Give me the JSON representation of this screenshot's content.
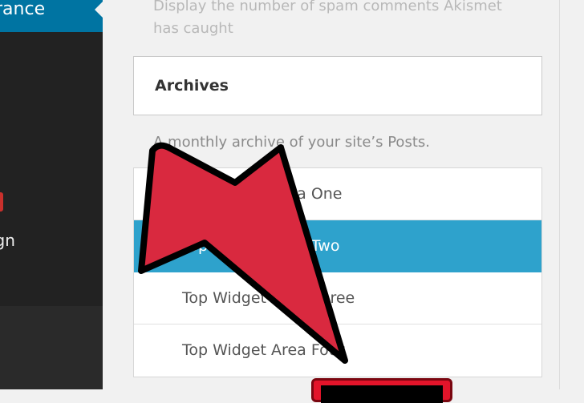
{
  "sidebar": {
    "active_item": "rance",
    "design_item": "ign"
  },
  "main": {
    "spam_desc": "Display the number of spam comments Akismet has caught",
    "widget_title": "Archives",
    "widget_desc": "A monthly archive of your site’s Posts."
  },
  "widget_areas": [
    {
      "label": "Top Widget Area One",
      "selected": false
    },
    {
      "label": "Top Widget Area Two",
      "selected": true
    },
    {
      "label": "Top Widget Area Three",
      "selected": false
    },
    {
      "label": "Top Widget Area Four",
      "selected": false
    }
  ],
  "colors": {
    "sidebar_bg": "#222222",
    "active_blue": "#0074a2",
    "selected_blue": "#2ea2cc",
    "arrow_red": "#d9293f",
    "button_red": "#e3142a"
  },
  "icons": {
    "check": "check-icon",
    "arrow": "pointer-arrow-icon"
  }
}
